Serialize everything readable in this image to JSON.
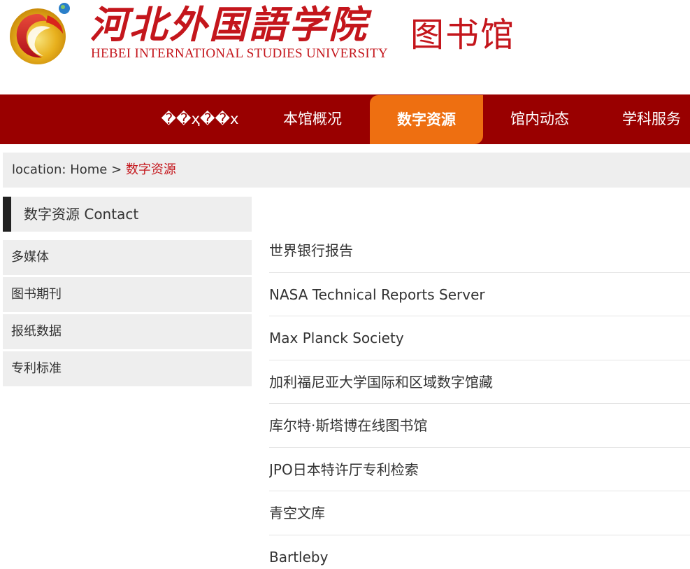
{
  "header": {
    "school_name_cn": "河北外国語学院",
    "school_name_en": "HEBEI INTERNATIONAL STUDIES UNIVERSITY",
    "library_name": "图书馆",
    "brand_color": "#c4161c"
  },
  "nav": {
    "items": [
      {
        "label": "��ҳ��x"
      },
      {
        "label": "本馆概况"
      },
      {
        "label": "数字资源"
      },
      {
        "label": "馆内动态"
      },
      {
        "label": "学科服务"
      }
    ],
    "active_index": 2,
    "bar_color": "#990000",
    "active_color": "#ee6f11"
  },
  "breadcrumb": {
    "prefix": "location:",
    "home": "Home",
    "separator": ">",
    "current": "数字资源"
  },
  "sidebar": {
    "title": "数字资源 Contact",
    "items": [
      {
        "label": "多媒体"
      },
      {
        "label": "图书期刊"
      },
      {
        "label": "报纸数据"
      },
      {
        "label": "专利标准"
      }
    ]
  },
  "content": {
    "items": [
      {
        "label": "世界银行报告"
      },
      {
        "label": "NASA Technical Reports Server"
      },
      {
        "label": "Max Planck Society"
      },
      {
        "label": "加利福尼亚大学国际和区域数字馆藏"
      },
      {
        "label": "库尔特·斯塔博在线图书馆"
      },
      {
        "label": "JPO日本特许厅专利检索"
      },
      {
        "label": "青空文库"
      },
      {
        "label": "Bartleby"
      }
    ]
  }
}
